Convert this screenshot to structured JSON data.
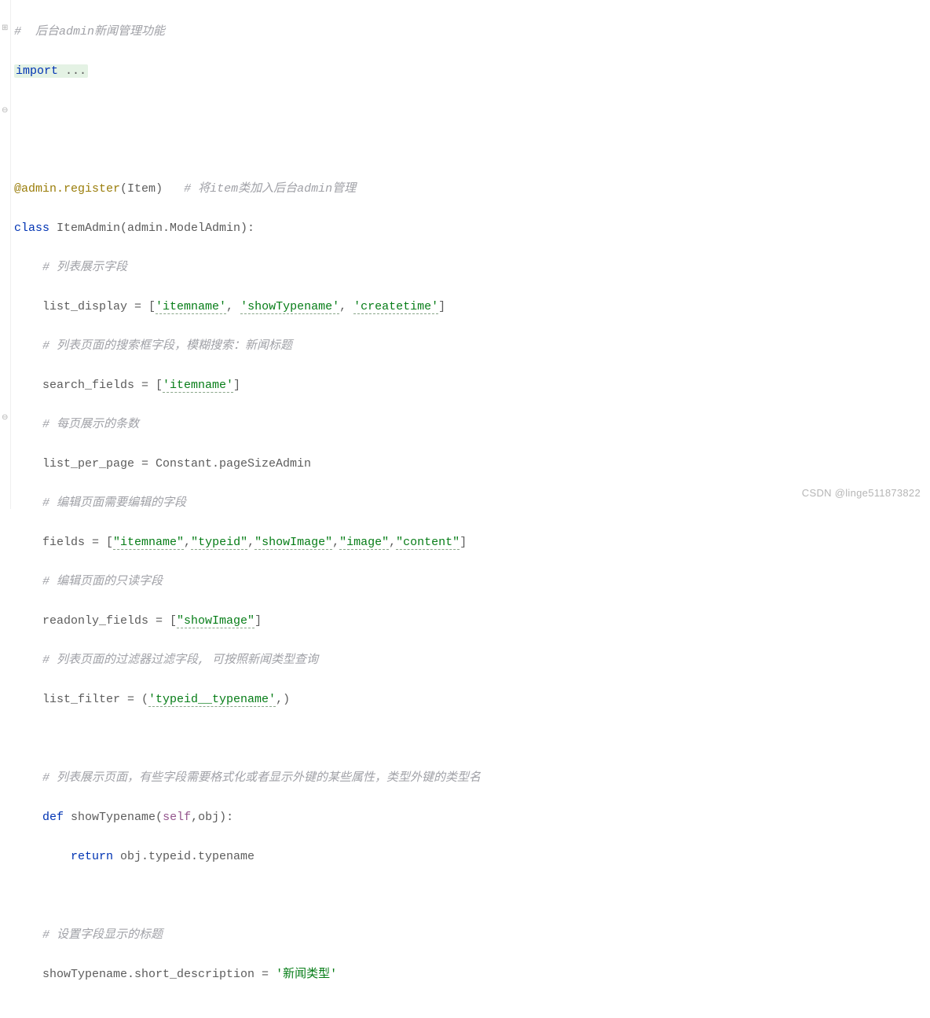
{
  "code": {
    "line01_comment": "#  后台admin新闻管理功能",
    "line02_import": "import",
    "line02_ellipsis": " ...",
    "line03_blank": "",
    "line04_blank": "",
    "line05_decorator_at": "@admin.register",
    "line05_decorator_paren_open": "(",
    "line05_decorator_arg": "Item",
    "line05_decorator_paren_close": ")",
    "line05_comment": "   # 将item类加入后台admin管理",
    "line06_class": "class ",
    "line06_classname": "ItemAdmin(admin.ModelAdmin):",
    "line07_comment": "    # 列表展示字段",
    "line08_a": "    list_display = [",
    "line08_s1": "'itemname'",
    "line08_c1": ", ",
    "line08_s2": "'showTypename'",
    "line08_c2": ", ",
    "line08_s3": "'createtime'",
    "line08_b": "]",
    "line09_comment": "    # 列表页面的搜索框字段，模糊搜索：新闻标题",
    "line10_a": "    search_fields = [",
    "line10_s1": "'itemname'",
    "line10_b": "]",
    "line11_comment": "    # 每页展示的条数",
    "line12": "    list_per_page = Constant.pageSizeAdmin",
    "line13_comment": "    # 编辑页面需要编辑的字段",
    "line14_a": "    fields = [",
    "line14_s1": "\"itemname\"",
    "line14_c1": ",",
    "line14_s2": "\"typeid\"",
    "line14_c2": ",",
    "line14_s3": "\"showImage\"",
    "line14_c3": ",",
    "line14_s4": "\"image\"",
    "line14_c4": ",",
    "line14_s5": "\"content\"",
    "line14_b": "]",
    "line15_comment": "    # 编辑页面的只读字段",
    "line16_a": "    readonly_fields = [",
    "line16_s1": "\"showImage\"",
    "line16_b": "]",
    "line17_comment": "    # 列表页面的过滤器过滤字段, 可按照新闻类型查询",
    "line18_a": "    list_filter = (",
    "line18_s1": "'typeid__typename'",
    "line18_b": ",)",
    "line19_blank": "",
    "line20_comment": "    # 列表展示页面，有些字段需要格式化或者显示外键的某些属性，类型外键的类型名",
    "line21_def": "    def ",
    "line21_name": "showTypename",
    "line21_paren_open": "(",
    "line21_self": "self",
    "line21_comma": ",",
    "line21_obj": "obj):",
    "line22_return": "        return ",
    "line22_expr": "obj.typeid.typename",
    "line23_blank": "",
    "line24_comment": "    # 设置字段显示的标题",
    "line25_a": "    showTypename.short_description = ",
    "line25_s1": "'新闻类型'"
  },
  "watermark": "CSDN @linge511873822"
}
